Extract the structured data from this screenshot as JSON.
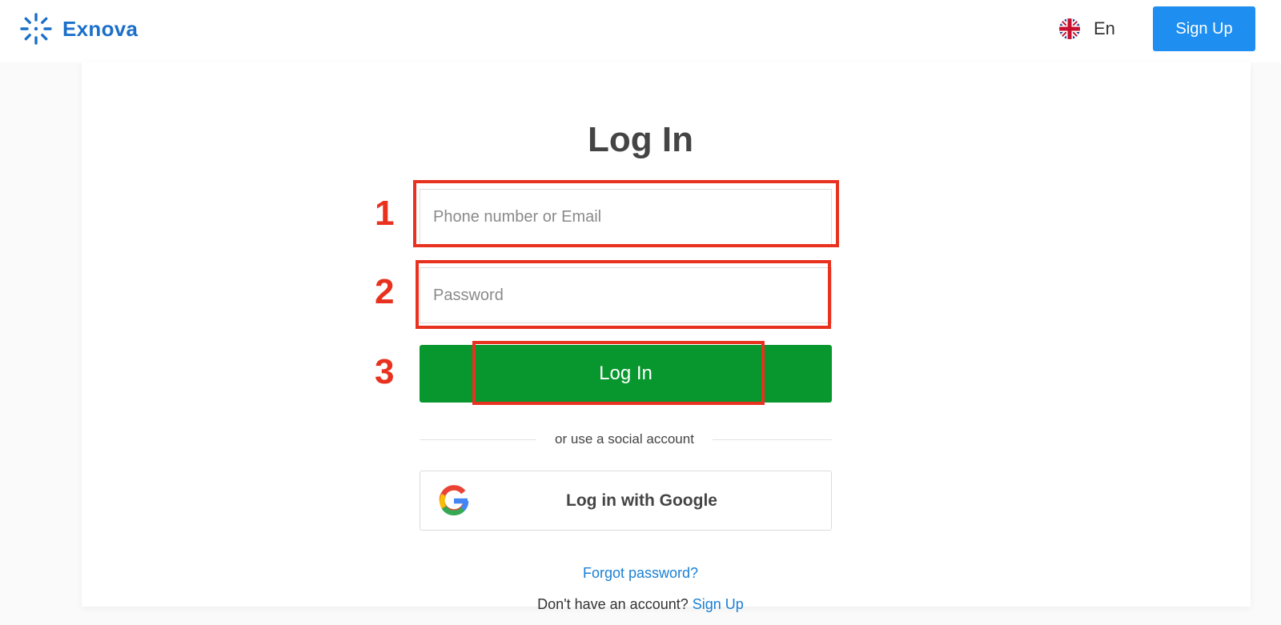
{
  "header": {
    "brand": "Exnova",
    "language": "En",
    "signup_label": "Sign Up"
  },
  "login": {
    "title": "Log In",
    "email_placeholder": "Phone number or Email",
    "password_placeholder": "Password",
    "submit_label": "Log In",
    "divider_text": "or use a social account",
    "google_label": "Log in with Google",
    "forgot_label": "Forgot password?",
    "no_account_text": "Don't have an account?",
    "no_account_link": "Sign Up"
  },
  "annotations": [
    "1",
    "2",
    "3"
  ],
  "icons": {
    "logo": "exnova-logo-icon",
    "language": "uk-flag-icon",
    "google": "google-g-icon"
  },
  "colors": {
    "brand": "#1a6fc9",
    "signup_button": "#1e8ff0",
    "login_button": "#08962e",
    "annotation": "#e8321f",
    "link": "#1a7fd4"
  }
}
